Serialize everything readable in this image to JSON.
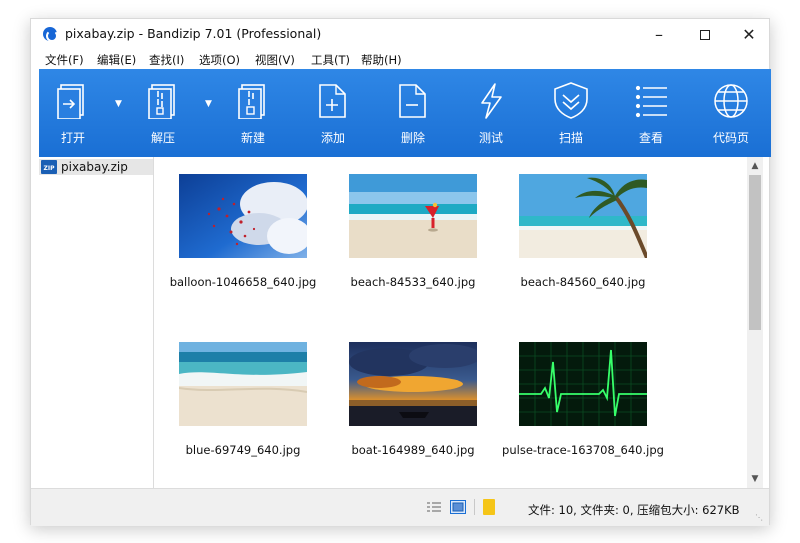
{
  "window": {
    "title": "pixabay.zip - Bandizip 7.01 (Professional)"
  },
  "menu": [
    {
      "label": "文件(F)"
    },
    {
      "label": "编辑(E)"
    },
    {
      "label": "查找(I)"
    },
    {
      "label": "选项(O)"
    },
    {
      "label": "视图(V)"
    },
    {
      "label": "工具(T)"
    },
    {
      "label": "帮助(H)"
    }
  ],
  "toolbar": [
    {
      "label": "打开",
      "icon": "open-icon"
    },
    {
      "label": "解压",
      "icon": "extract-icon"
    },
    {
      "label": "新建",
      "icon": "new-archive-icon"
    },
    {
      "label": "添加",
      "icon": "add-file-icon"
    },
    {
      "label": "删除",
      "icon": "delete-file-icon"
    },
    {
      "label": "测试",
      "icon": "lightning-icon"
    },
    {
      "label": "扫描",
      "icon": "shield-icon"
    },
    {
      "label": "查看",
      "icon": "list-icon"
    },
    {
      "label": "代码页",
      "icon": "globe-icon"
    }
  ],
  "sidebar": {
    "root": "pixabay.zip",
    "zip_badge": "ZIP"
  },
  "files": [
    {
      "name": "balloon-1046658_640.jpg"
    },
    {
      "name": "beach-84533_640.jpg"
    },
    {
      "name": "beach-84560_640.jpg"
    },
    {
      "name": "blue-69749_640.jpg"
    },
    {
      "name": "boat-164989_640.jpg"
    },
    {
      "name": "pulse-trace-163708_640.jpg"
    }
  ],
  "status": {
    "text": "文件: 10, 文件夹: 0, 压缩包大小: 627KB"
  },
  "colors": {
    "toolbar": "#1a6fd4",
    "accent": "#2f87e6"
  }
}
